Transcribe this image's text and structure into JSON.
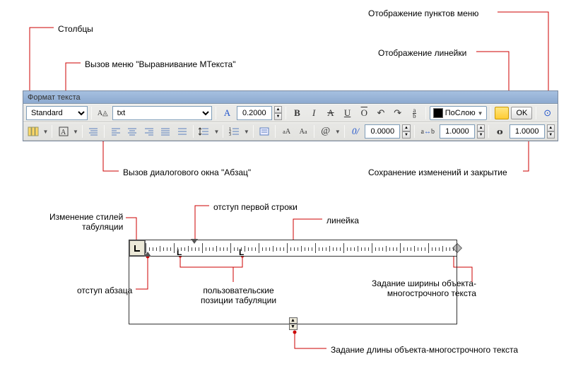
{
  "callouts": {
    "columns": "Столбцы",
    "mtext_align_menu": "Вызов меню \"Выравнивание МТекста\"",
    "display_menu_items": "Отображение пунктов меню",
    "display_ruler": "Отображение линейки",
    "paragraph_dialog": "Вызов диалогового окна \"Абзац\"",
    "save_close": "Сохранение изменений и закрытие",
    "first_line_indent": "отступ первой строки",
    "tab_style_change": "Изменение стилей\nтабуляции",
    "ruler": "линейка",
    "para_indent": "отступ абзаца",
    "user_tab_positions": "пользовательские\nпозиции табуляции",
    "set_width": "Задание ширины объекта-\nмногострочного текста",
    "set_length": "Задание длины объекта-многострочного текста"
  },
  "toolbar": {
    "title": "Формат текста",
    "style_options": [
      "Standard"
    ],
    "font_prefix": "A",
    "font_options": [
      "txt"
    ],
    "text_height": "0.2000",
    "bold": "B",
    "italic": "I",
    "strike": "A",
    "underline": "U",
    "overline": "O",
    "undo_tip": "↶",
    "redo_tip": "↷",
    "stack": "a/b",
    "color_label": "ПоСлою",
    "ok": "OK",
    "options_icon": "⊙",
    "oblique_label": "0/",
    "oblique": "0.0000",
    "tracking_label": "a-b",
    "tracking": "1.0000",
    "width_label": "O",
    "width_factor": "1.0000",
    "at_symbol": "@"
  }
}
